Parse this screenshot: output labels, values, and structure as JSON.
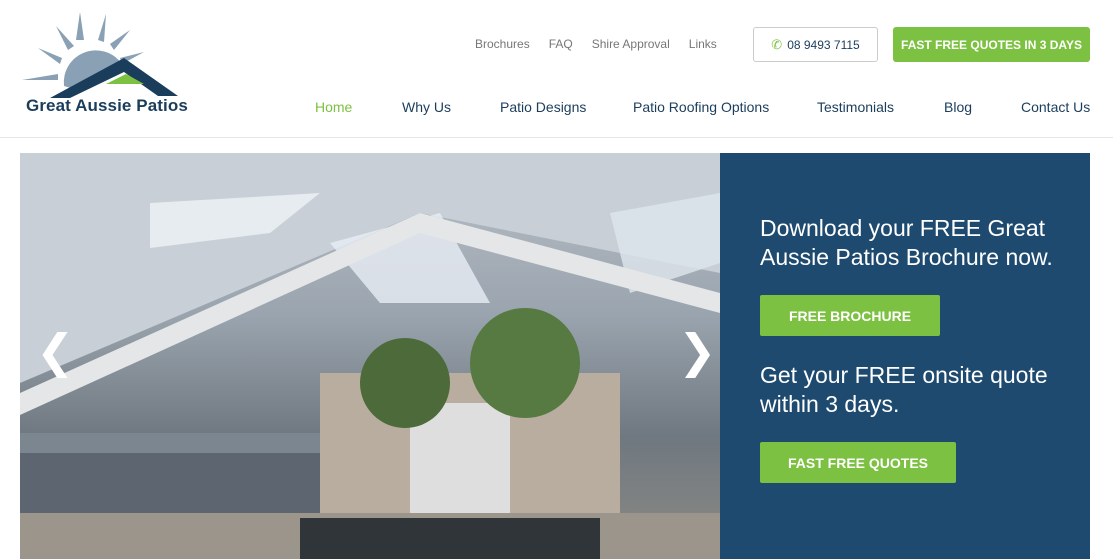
{
  "logo": {
    "text": "Great Aussie Patios"
  },
  "top_links": [
    "Brochures",
    "FAQ",
    "Shire Approval",
    "Links"
  ],
  "phone": {
    "icon": "phone-icon",
    "number": "08 9493 7115"
  },
  "cta": "FAST FREE QUOTES IN 3 DAYS",
  "nav": [
    {
      "label": "Home",
      "active": true
    },
    {
      "label": "Why Us"
    },
    {
      "label": "Patio Designs"
    },
    {
      "label": "Patio Roofing Options"
    },
    {
      "label": "Testimonials"
    },
    {
      "label": "Blog"
    },
    {
      "label": "Contact Us"
    }
  ],
  "hero": {
    "heading1": "Download your FREE Great Aussie Patios Brochure now.",
    "button1": "FREE BROCHURE",
    "heading2": "Get your FREE onsite quote within 3 days.",
    "button2": "FAST FREE QUOTES",
    "prev_icon": "chevron-left-icon",
    "next_icon": "chevron-right-icon"
  },
  "colors": {
    "green": "#7dc142",
    "navy": "#1b3d5c",
    "panel": "#1d4a6e"
  }
}
